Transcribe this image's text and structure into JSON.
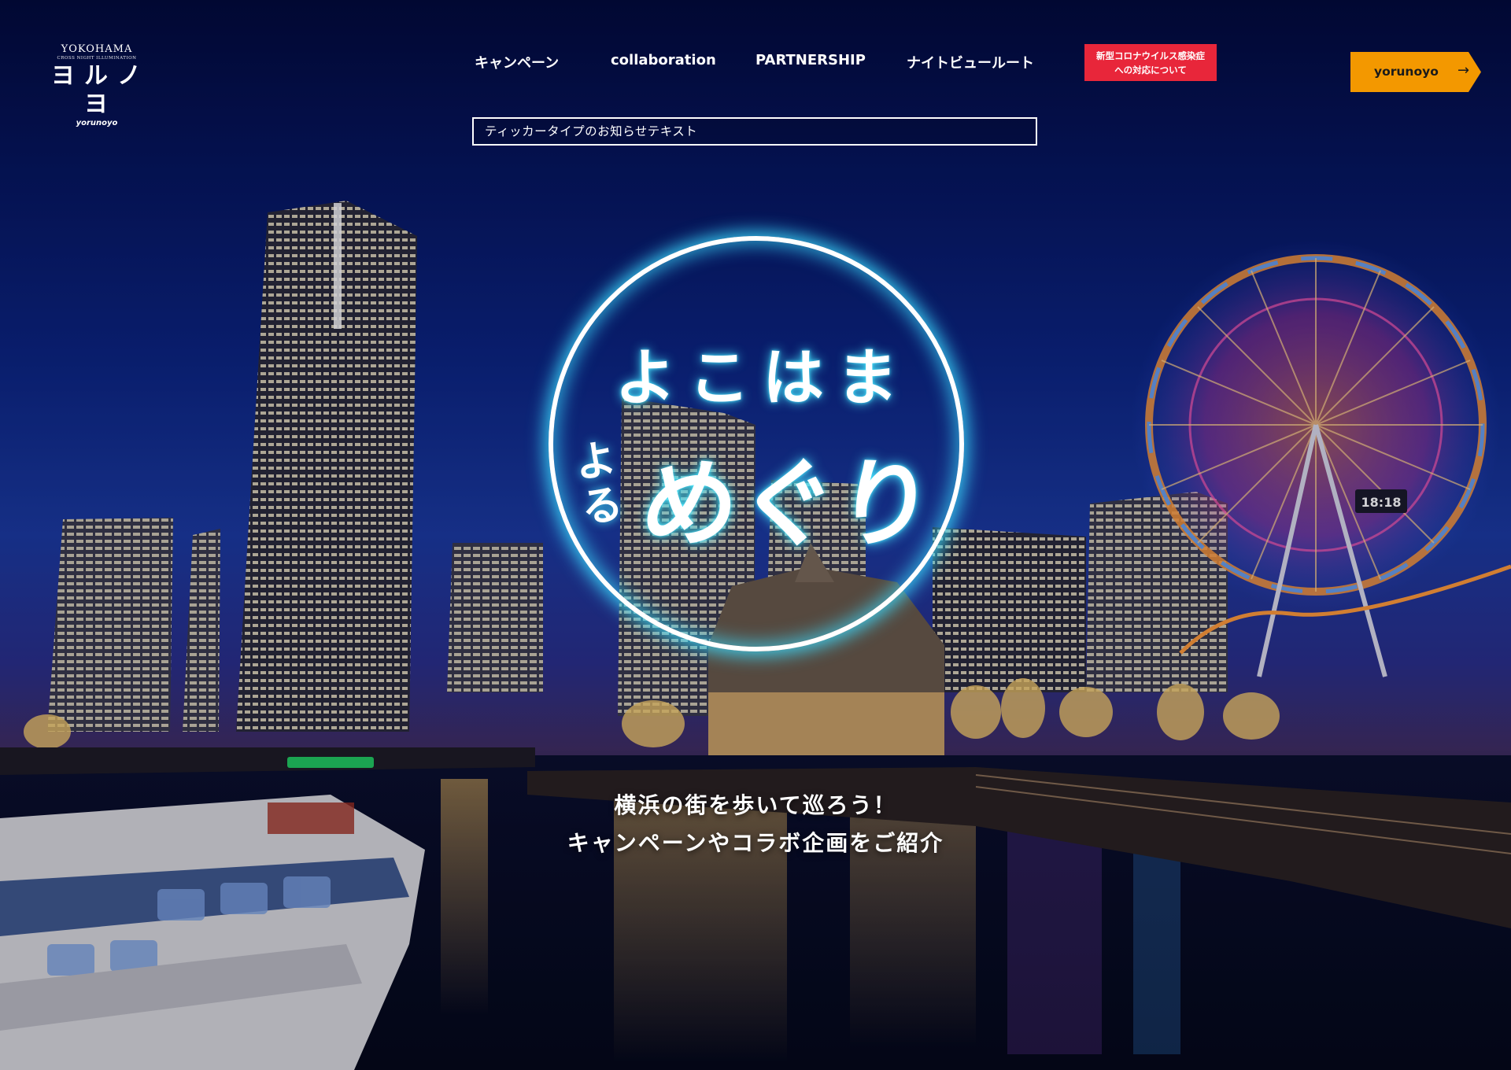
{
  "brand": {
    "city": "YOKOHAMA",
    "subtitle": "CROSS NIGHT ILLUMINATION",
    "name_kana": "ヨルノヨ",
    "name_romaji": "yorunoyo"
  },
  "nav": {
    "items": [
      {
        "label": "キャンペーン"
      },
      {
        "label": "collaboration"
      },
      {
        "label": "PARTNERSHIP"
      },
      {
        "label": "ナイトビュールート"
      }
    ]
  },
  "notice_button": {
    "line1": "新型コロナウイルス感染症",
    "line2": "への対応について",
    "color": "#e8263a"
  },
  "cta": {
    "label": "yorunoyo",
    "icon": "arrow-right-icon",
    "color": "#f39800"
  },
  "ticker": {
    "text": "ティッカータイプのお知らせテキスト"
  },
  "hero": {
    "emblem_line1": "よこはま",
    "emblem_yoru": "よる",
    "emblem_line2": "めぐり",
    "ferris_clock": "18:18",
    "tagline_line1": "横浜の街を歩いて巡ろう！",
    "tagline_line2": "キャンペーンやコラボ企画をご紹介",
    "glow_color": "#3cdcff"
  }
}
